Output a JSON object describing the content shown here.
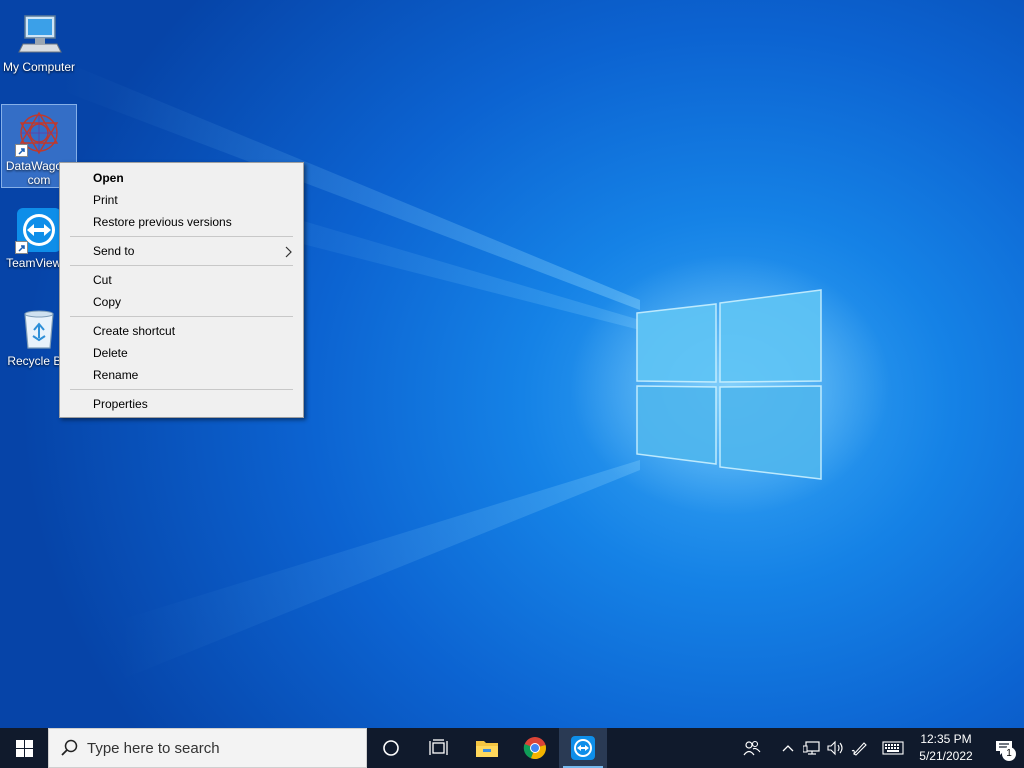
{
  "desktop": {
    "icons": [
      {
        "label": "My Computer"
      },
      {
        "label": "DataWagon.com"
      },
      {
        "label": "TeamViewer"
      },
      {
        "label": "Recycle Bin"
      }
    ]
  },
  "context_menu": {
    "items": [
      {
        "label": "Open"
      },
      {
        "label": "Print"
      },
      {
        "label": "Restore previous versions"
      },
      {
        "label": "Send to"
      },
      {
        "label": "Cut"
      },
      {
        "label": "Copy"
      },
      {
        "label": "Create shortcut"
      },
      {
        "label": "Delete"
      },
      {
        "label": "Rename"
      },
      {
        "label": "Properties"
      }
    ]
  },
  "taskbar": {
    "search_placeholder": "Type here to search",
    "pinned_apps": [
      "file-explorer-icon",
      "chrome-icon",
      "teamviewer-icon"
    ],
    "tray": {
      "time": "12:35 PM",
      "date": "5/21/2022",
      "notification_count": "1"
    }
  },
  "colors": {
    "taskbar": "#101a2c",
    "menu_background": "#f0f0f0",
    "wallpaper_accent": "#1582e6"
  }
}
